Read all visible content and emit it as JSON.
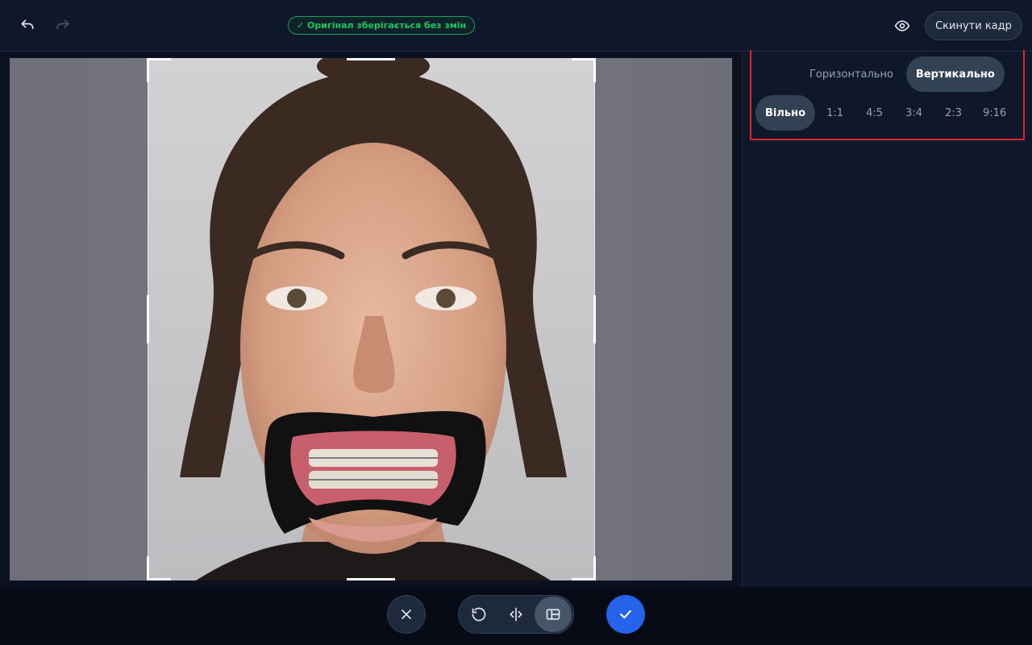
{
  "topbar": {
    "undo_icon": "undo-icon",
    "redo_icon": "redo-icon",
    "status_badge": "✓ Оригінал зберігається без змін",
    "preview_icon": "eye-icon",
    "reset_button": "Скинути кадр"
  },
  "panel": {
    "orientation": [
      {
        "label": "Горизонтально",
        "active": false
      },
      {
        "label": "Вертикально",
        "active": true
      }
    ],
    "ratios": [
      {
        "label": "Вільно",
        "active": true
      },
      {
        "label": "1:1",
        "active": false
      },
      {
        "label": "4:5",
        "active": false
      },
      {
        "label": "3:4",
        "active": false
      },
      {
        "label": "2:3",
        "active": false
      },
      {
        "label": "9:16",
        "active": false
      }
    ]
  },
  "bottombar": {
    "cancel_icon": "close-icon",
    "tools": [
      {
        "icon": "rotate-icon",
        "active": false
      },
      {
        "icon": "flip-icon",
        "active": false
      },
      {
        "icon": "crop-layout-icon",
        "active": true
      }
    ],
    "confirm_icon": "check-icon"
  },
  "colors": {
    "accent": "#2563eb",
    "success": "#22c55e",
    "highlight_border": "#dc2626"
  }
}
